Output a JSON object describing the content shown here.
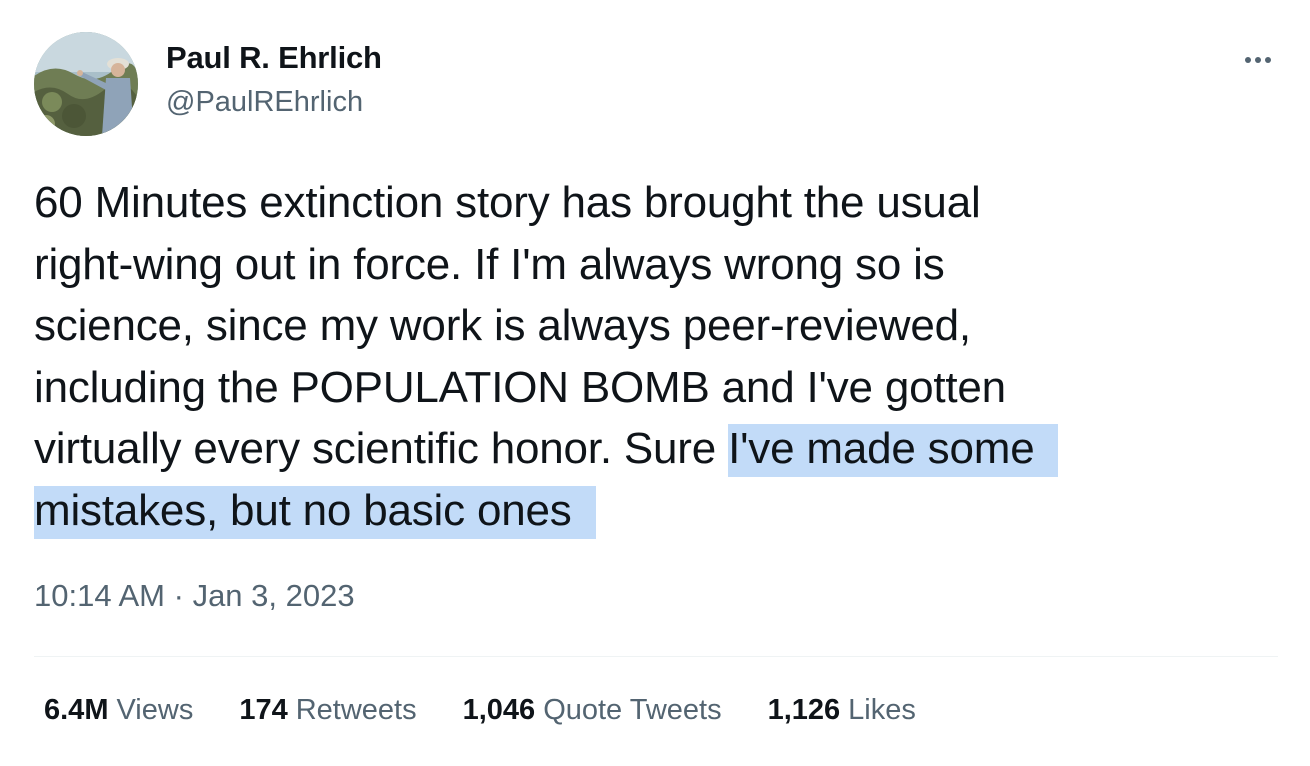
{
  "author": {
    "display_name": "Paul R. Ehrlich",
    "handle": "@PaulREhrlich",
    "avatar": "profile-photo"
  },
  "menu_icon": "more-horizontal-icon",
  "tweet": {
    "text_before": "60 Minutes extinction story has brought the usual\nright-wing out in force.  If I'm always wrong so is\nscience, since my work is always peer-reviewed,\nincluding the POPULATION BOMB and I've gotten\nvirtually every scientific honor. Sure ",
    "text_highlighted_1": "I've made some",
    "text_highlighted_2": "mistakes, but no basic ones",
    "highlight_color": "#c2dbf8"
  },
  "meta": {
    "time": "10:14 AM",
    "separator": "·",
    "date": "Jan 3, 2023"
  },
  "stats": {
    "views": {
      "count": "6.4M",
      "label": "Views"
    },
    "retweets": {
      "count": "174",
      "label": "Retweets"
    },
    "quote_tweets": {
      "count": "1,046",
      "label": "Quote Tweets"
    },
    "likes": {
      "count": "1,126",
      "label": "Likes"
    }
  },
  "colors": {
    "text": "#0f1419",
    "secondary": "#536471",
    "divider": "#eff3f4"
  }
}
